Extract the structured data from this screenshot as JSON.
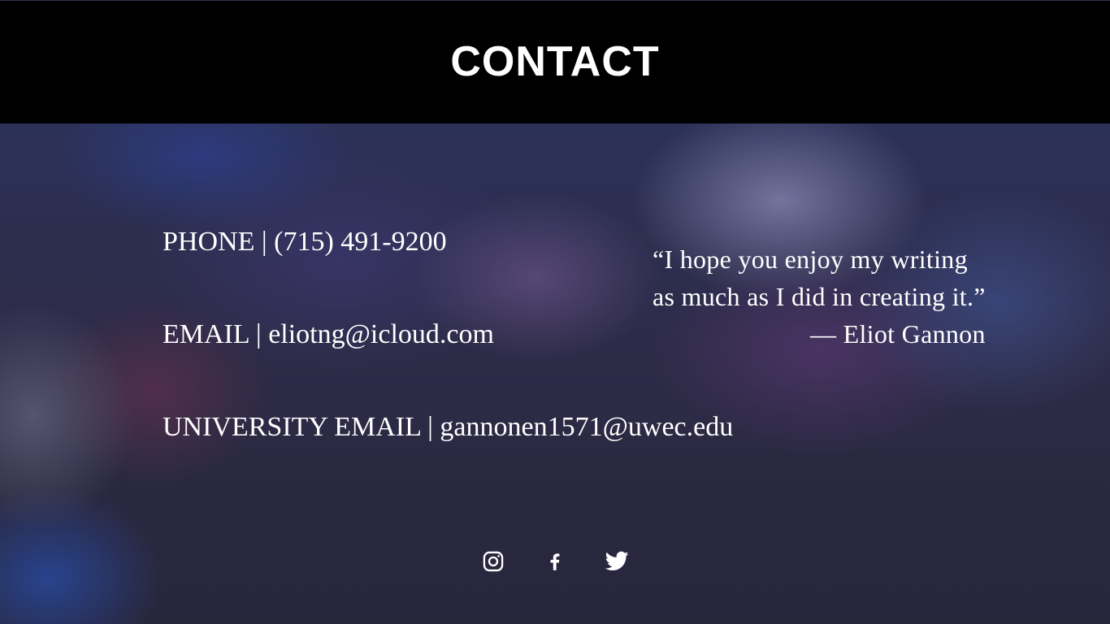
{
  "header": {
    "title": "CONTACT"
  },
  "contact": {
    "phone": "PHONE | (715) 491-9200",
    "email": "EMAIL | eliotng@icloud.com",
    "university_email": "UNIVERSITY EMAIL | gannonen1571@uwec.edu"
  },
  "quote": {
    "line1": "“I hope you enjoy my writing",
    "line2": "as much as I did in creating it.”",
    "author": "— Eliot Gannon"
  },
  "social": {
    "icons": [
      "instagram-icon",
      "facebook-icon",
      "twitter-icon"
    ]
  },
  "colors": {
    "header_bg": "#000000",
    "text": "#ffffff"
  }
}
